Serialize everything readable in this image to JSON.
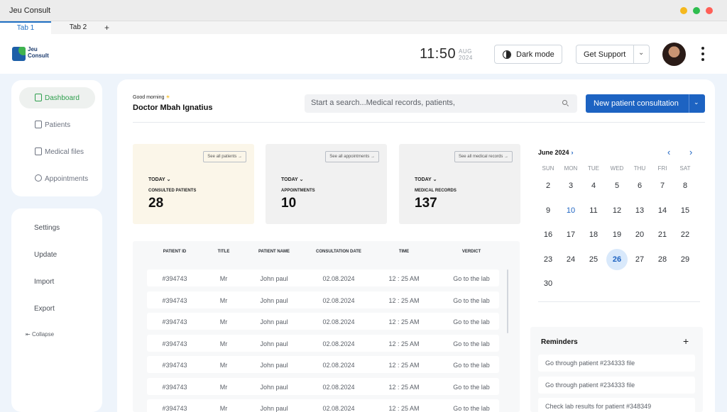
{
  "window": {
    "title": "Jeu Consult",
    "tabs": [
      "Tab 1",
      "Tab 2"
    ],
    "add_tab": "+",
    "controls": {
      "minimize_color": "#f5b81d",
      "maximize_color": "#2ebd4e",
      "close_color": "#ff5f57"
    }
  },
  "header": {
    "logo_text": "Jeu Consult",
    "logo_word1": "Jeu",
    "logo_word2": "Consult",
    "time": "11:50",
    "date_month": "AUG",
    "date_year": "2024",
    "dark_mode_label": "Dark mode",
    "support_label": "Get Support",
    "support_chevron": "⌄",
    "avatar_icon": "user-avatar",
    "menu_icon": "kebab-menu-icon"
  },
  "sidebar": {
    "items": [
      {
        "label": "Dashboard",
        "icon": "dashboard-icon",
        "active": true
      },
      {
        "label": "Patients",
        "icon": "patients-icon",
        "active": false
      },
      {
        "label": "Medical files",
        "icon": "file-icon",
        "active": false
      },
      {
        "label": "Appointments",
        "icon": "clock-icon",
        "active": false
      }
    ],
    "settings": [
      "Settings",
      "Update",
      "Import",
      "Export"
    ],
    "collapse_label": "Collapse",
    "active_color": "#2e9f4d"
  },
  "main": {
    "greeting": "Good morning",
    "greeting_icon": "☀",
    "doctor_name": "Doctor Mbah Ignatius",
    "search_placeholder": "Start a search...Medical records, patients,",
    "new_button": "New patient consultation",
    "new_button_chevron": "⌄",
    "accent": "#1d63c2"
  },
  "stats": [
    {
      "see_all": "See all patients",
      "filter": "TODAY",
      "caption": "CONSULTED PATIENTS",
      "value": "28",
      "bg": "#fbf6e9"
    },
    {
      "see_all": "See all appointments",
      "filter": "TODAY",
      "caption": "APPOINTMENTS",
      "value": "10",
      "bg": "#f1f1f1"
    },
    {
      "see_all": "See all medical records",
      "filter": "TODAY",
      "caption": "MEDICAL RECORDS",
      "value": "137",
      "bg": "#f1f1f1"
    }
  ],
  "table": {
    "columns": [
      "PATIENT ID",
      "TITLE",
      "PATIENT NAME",
      "CONSULTATION DATE",
      "TIME",
      "VERDICT"
    ],
    "rows": [
      [
        "#394743",
        "Mr",
        "John paul",
        "02.08.2024",
        "12 : 25 AM",
        "Go to the lab"
      ],
      [
        "#394743",
        "Mr",
        "John paul",
        "02.08.2024",
        "12 : 25 AM",
        "Go to the lab"
      ],
      [
        "#394743",
        "Mr",
        "John paul",
        "02.08.2024",
        "12 : 25 AM",
        "Go to the lab"
      ],
      [
        "#394743",
        "Mr",
        "John paul",
        "02.08.2024",
        "12 : 25 AM",
        "Go to the lab"
      ],
      [
        "#394743",
        "Mr",
        "John paul",
        "02.08.2024",
        "12 : 25 AM",
        "Go to the lab"
      ],
      [
        "#394743",
        "Mr",
        "John paul",
        "02.08.2024",
        "12 : 25 AM",
        "Go to the lab"
      ],
      [
        "#394743",
        "Mr",
        "John paul",
        "02.08.2024",
        "12 : 25 AM",
        "Go to the lab"
      ]
    ]
  },
  "calendar": {
    "month": "June 2024",
    "prev": "‹",
    "next": "›",
    "weekdays": [
      "SUN",
      "MON",
      "TUE",
      "WED",
      "THU",
      "FRI",
      "SAT"
    ],
    "weeks": [
      [
        "2",
        "3",
        "4",
        "5",
        "6",
        "7",
        "8"
      ],
      [
        "9",
        "10",
        "11",
        "12",
        "13",
        "14",
        "15"
      ],
      [
        "16",
        "17",
        "18",
        "19",
        "20",
        "21",
        "22"
      ],
      [
        "23",
        "24",
        "25",
        "26",
        "27",
        "28",
        "29"
      ],
      [
        "30"
      ]
    ],
    "selected_day": "26",
    "highlight_day": "10"
  },
  "reminders": {
    "title": "Reminders",
    "add": "+",
    "items": [
      "Go through patient #234333 file",
      "Go through patient #234333 file",
      "Check lab results for patient #348349"
    ]
  }
}
